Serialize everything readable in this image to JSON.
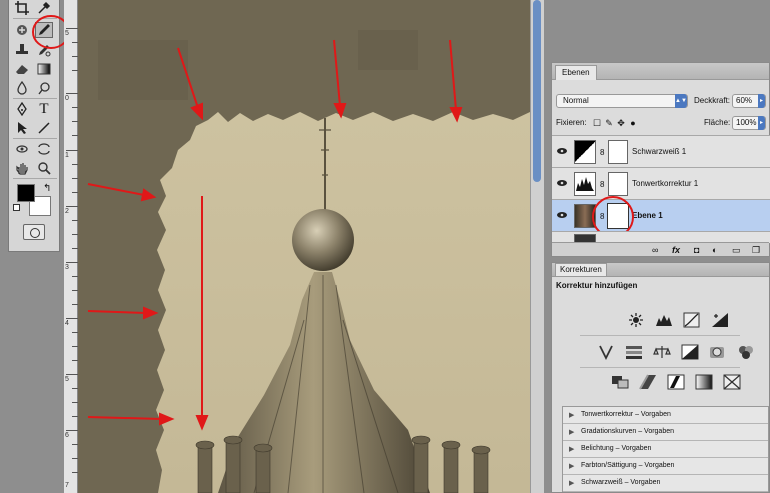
{
  "layers_panel": {
    "tab_label": "Ebenen",
    "blend_mode": "Normal",
    "opacity_label": "Deckkraft:",
    "opacity_value": "60%",
    "lock_label": "Fixieren:",
    "fill_label": "Fläche:",
    "fill_value": "100%",
    "layers": [
      {
        "name": "Schwarzweiß 1"
      },
      {
        "name": "Tonwertkorrektur 1"
      },
      {
        "name": "Ebene 1"
      }
    ]
  },
  "adjustments_panel": {
    "tab_label": "Korrekturen",
    "subtitle": "Korrektur hinzufügen",
    "presets": [
      "Tonwertkorrektur – Vorgaben",
      "Gradationskurven – Vorgaben",
      "Belichtung – Vorgaben",
      "Farbton/Sättigung – Vorgaben",
      "Schwarzweiß – Vorgaben"
    ]
  },
  "ruler": {
    "labels": [
      "5",
      "0",
      "1",
      "2",
      "3",
      "4",
      "5",
      "6",
      "7",
      "8"
    ]
  },
  "colors": {
    "highlight_circle": "#e01818",
    "annotation_arrow": "#e01818",
    "selection": "#b8cff0",
    "border_dark": "#6a624f",
    "photo_paper": "#c8bb98"
  },
  "icons": [
    "crop-icon",
    "eyedropper-icon",
    "healing-brush-icon",
    "brush-icon",
    "stamp-icon",
    "history-brush-icon",
    "eraser-icon",
    "gradient-icon",
    "blur-icon",
    "dodge-icon",
    "pen-icon",
    "type-icon",
    "path-select-icon",
    "line-icon",
    "3d-rotate-icon",
    "3d-orbit-icon",
    "hand-icon",
    "zoom-icon"
  ]
}
